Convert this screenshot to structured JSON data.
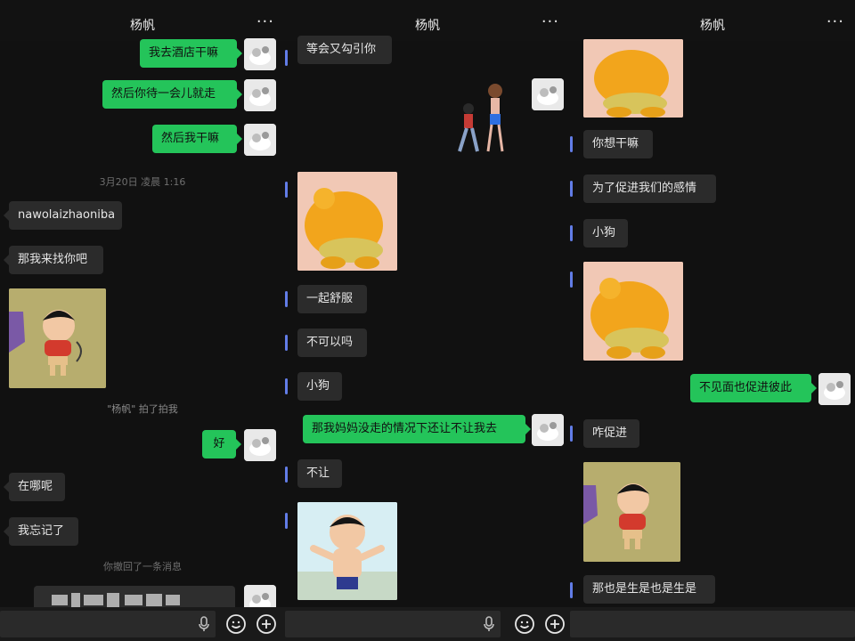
{
  "panels": [
    {
      "contact_name": "杨帆",
      "more_label": "···",
      "messages": {
        "m1": "我去酒店干嘛",
        "m2": "然后你待一会儿就走",
        "m3": "然后我干嘛",
        "time": "3月20日 凌晨 1:16",
        "m4": "nawolaizhaoniba",
        "m5": "那我来找你吧",
        "pat": "\"杨帆\" 拍了拍我",
        "m6": "好",
        "m7": "在哪呢",
        "m8": "我忘记了",
        "recall": "你撤回了一条消息"
      },
      "images": {
        "sticker_1": "crayon-shin-chan-sticker"
      },
      "icons": {
        "mic": "mic-icon",
        "emoji": "emoji-icon",
        "plus": "plus-icon"
      }
    },
    {
      "contact_name": "杨帆",
      "more_label": "···",
      "messages": {
        "m1": "等会又勾引你",
        "m2": "一起舒服",
        "m3": "不可以吗",
        "m4": "小狗",
        "m5": "那我妈妈没走的情况下还让不让我去",
        "m6": "不让"
      },
      "images": {
        "sticker_1": "couple-sticker",
        "sticker_2": "orange-plush-sticker",
        "sticker_3": "crayon-shin-chan-sticker"
      },
      "icons": {
        "mic": "mic-icon",
        "emoji": "emoji-icon",
        "plus": "plus-icon"
      }
    },
    {
      "contact_name": "杨帆",
      "more_label": "···",
      "messages": {
        "m1": "你想干嘛",
        "m2": "为了促进我们的感情",
        "m3": "小狗",
        "m4": "不见面也促进彼此",
        "m5": "咋促进",
        "m6": "那也是生是也是生是"
      },
      "images": {
        "sticker_1": "orange-plush-sticker",
        "sticker_2": "orange-plush-sticker",
        "sticker_3": "crayon-shin-chan-sticker"
      }
    }
  ],
  "colors": {
    "outgoing_bubble": "#24c45a",
    "incoming_bubble": "#2b2b2b",
    "background": "#111111",
    "system_text": "#6f6f6f"
  }
}
